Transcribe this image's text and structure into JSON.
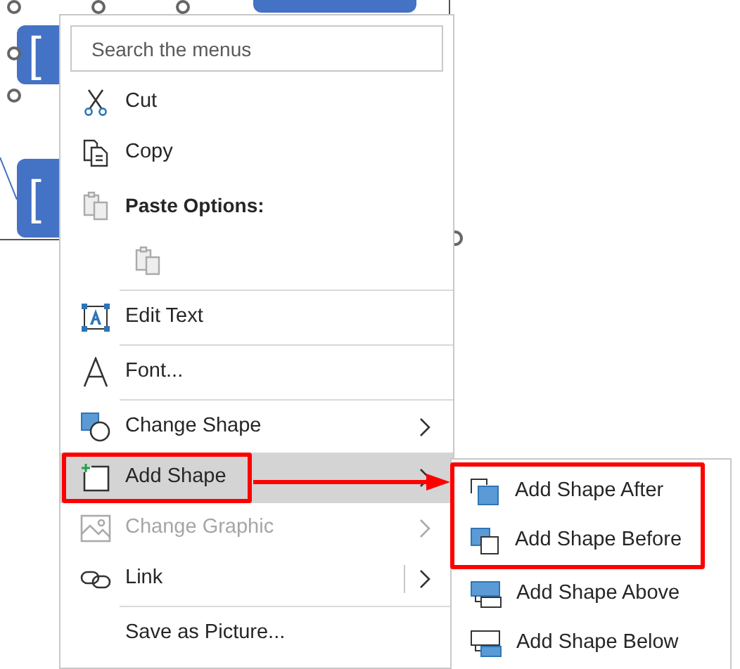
{
  "canvas": {
    "shapes": [
      {
        "label": "["
      },
      {
        "label": "["
      }
    ]
  },
  "search": {
    "placeholder": "Search the menus"
  },
  "menu": {
    "groups": [
      [
        {
          "kind": "item",
          "label": "Cut",
          "submenu": false,
          "selected": false,
          "disabled": false,
          "split": false,
          "annotated": false
        },
        {
          "kind": "item",
          "label": "Copy",
          "submenu": false,
          "selected": false,
          "disabled": false,
          "split": false,
          "annotated": false
        },
        {
          "kind": "header",
          "label": "Paste Options:"
        },
        {
          "kind": "paste_option"
        }
      ],
      [
        {
          "kind": "item",
          "label": "Edit Text",
          "submenu": false,
          "selected": false,
          "disabled": false,
          "split": false,
          "annotated": false
        }
      ],
      [
        {
          "kind": "item",
          "label": "Font...",
          "submenu": false,
          "selected": false,
          "disabled": false,
          "split": false,
          "annotated": false
        }
      ],
      [
        {
          "kind": "item",
          "label": "Change Shape",
          "submenu": true,
          "selected": false,
          "disabled": false,
          "split": false,
          "annotated": false
        },
        {
          "kind": "item",
          "label": "Add Shape",
          "submenu": true,
          "selected": true,
          "disabled": false,
          "split": false,
          "annotated": true
        },
        {
          "kind": "item",
          "label": "Change Graphic",
          "submenu": true,
          "selected": false,
          "disabled": true,
          "split": false,
          "annotated": false
        },
        {
          "kind": "item",
          "label": "Link",
          "submenu": true,
          "selected": false,
          "disabled": false,
          "split": true,
          "annotated": false
        }
      ],
      [
        {
          "kind": "item",
          "label": "Save as Picture...",
          "submenu": false,
          "selected": false,
          "disabled": false,
          "split": false,
          "annotated": false
        }
      ]
    ]
  },
  "submenu": {
    "items": [
      {
        "label": "Add Shape After",
        "annotated": true
      },
      {
        "label": "Add Shape Before",
        "annotated": true
      },
      {
        "label": "Add Shape Above",
        "annotated": false
      },
      {
        "label": "Add Shape Below",
        "annotated": false
      }
    ]
  }
}
